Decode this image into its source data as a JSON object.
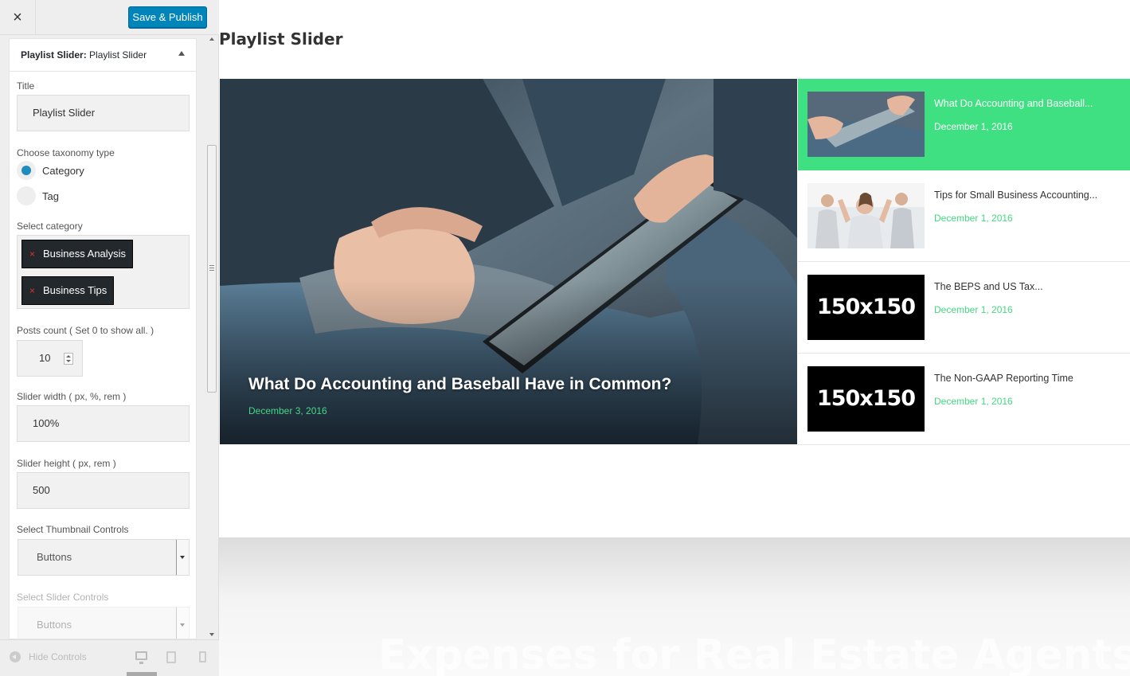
{
  "topbar": {
    "close_icon": "×",
    "save_label": "Save & Publish"
  },
  "panel": {
    "header_bold": "Playlist Slider:",
    "header_name": "Playlist Slider",
    "title_label": "Title",
    "title_value": "Playlist Slider",
    "taxonomy_label": "Choose taxonomy type",
    "taxonomy_options": [
      {
        "label": "Category",
        "selected": true
      },
      {
        "label": "Tag",
        "selected": false
      }
    ],
    "category_label": "Select category",
    "selected_categories": [
      "Business Analysis",
      "Business Tips"
    ],
    "chip_remove": "×",
    "posts_count_label": "Posts count ( Set 0 to show all. )",
    "posts_count_value": "10",
    "slider_width_label": "Slider width ( px, %, rem )",
    "slider_width_value": "100%",
    "slider_height_label": "Slider height ( px, rem )",
    "slider_height_value": "500",
    "thumbnail_controls_label": "Select Thumbnail Controls",
    "thumbnail_controls_value": "Buttons",
    "slider_controls_label": "Select Slider Controls",
    "slider_controls_value": "Buttons"
  },
  "footer": {
    "hide_controls": "Hide Controls"
  },
  "preview": {
    "title": "Playlist Slider",
    "main": {
      "caption": "What Do Accounting and Baseball Have in Common?",
      "date": "December 3, 2016"
    },
    "playlist": [
      {
        "title": "What Do Accounting and Baseball...",
        "date": "December 1, 2016",
        "thumb": "photo-tablet",
        "active": true
      },
      {
        "title": "Tips for Small Business Accounting...",
        "date": "December 1, 2016",
        "thumb": "photo-team",
        "active": false
      },
      {
        "title": "The BEPS and US Tax...",
        "date": "December 1, 2016",
        "thumb": "150x150",
        "active": false
      },
      {
        "title": "The Non-GAAP Reporting Time",
        "date": "December 1, 2016",
        "thumb": "150x150",
        "active": false
      }
    ],
    "ghost_text": "Expenses for Real Estate Agents"
  },
  "colors": {
    "accent_green": "#3fe081",
    "date_green": "#45d882",
    "button_blue": "#0085ba",
    "chip_dark": "#23282d"
  }
}
